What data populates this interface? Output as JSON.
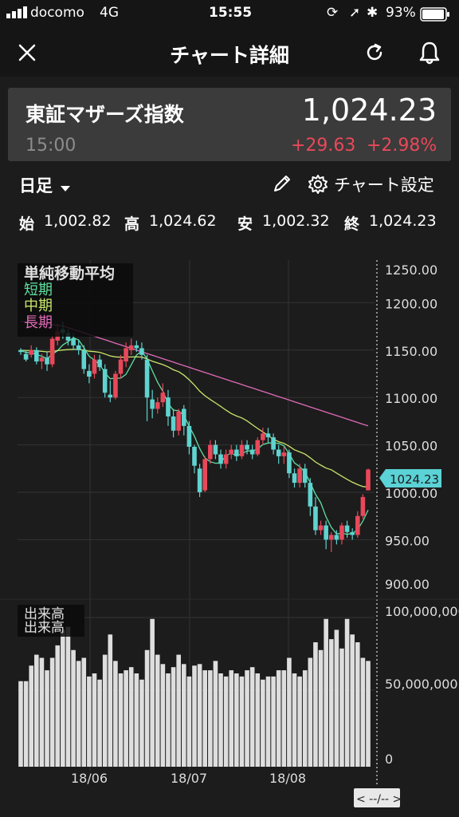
{
  "status_bar": {
    "carrier": "docomo",
    "network": "4G",
    "time": "15:55",
    "battery": "93%"
  },
  "nav": {
    "title": "チャート詳細"
  },
  "stock": {
    "name": "東証マザーズ指数",
    "price": "1,024.23",
    "time": "15:00",
    "change": "+29.63",
    "change_pct": "+2.98%"
  },
  "controls": {
    "period": "日足",
    "settings": "チャート設定"
  },
  "ohlc": {
    "open_label": "始",
    "open": "1,002.82",
    "high_label": "高",
    "high": "1,024.62",
    "low_label": "安",
    "low": "1,002.32",
    "close_label": "終",
    "close": "1,024.23"
  },
  "colors": {
    "up": "#e8485a",
    "down": "#5fd3cf",
    "short": "#5ee0a0",
    "mid": "#c8e66a",
    "long": "#e06ab8",
    "accent": "#5bd2d6"
  },
  "chart_data": {
    "type": "candlestick",
    "legend": {
      "title": "単純移動平均",
      "items": [
        "短期",
        "中期",
        "長期"
      ]
    },
    "y_ticks": [
      "1250.00",
      "1200.00",
      "1150.00",
      "1100.00",
      "1050.00",
      "1000.00",
      "950.00",
      "900.00"
    ],
    "x_ticks": [
      "18/06",
      "18/07",
      "18/08"
    ],
    "current_label": "1024.23",
    "volume_label": "出来高",
    "volume_ticks": [
      "100,000,000",
      "50,000,000",
      "0"
    ],
    "scroll_label": "< --/-- >",
    "candles": [
      [
        1150,
        1148,
        1152,
        1145
      ],
      [
        1146,
        1140,
        1150,
        1138
      ],
      [
        1145,
        1150,
        1155,
        1142
      ],
      [
        1150,
        1138,
        1153,
        1135
      ],
      [
        1138,
        1142,
        1146,
        1130
      ],
      [
        1142,
        1135,
        1148,
        1128
      ],
      [
        1135,
        1162,
        1165,
        1132
      ],
      [
        1160,
        1170,
        1178,
        1155
      ],
      [
        1172,
        1168,
        1180,
        1162
      ],
      [
        1168,
        1160,
        1172,
        1155
      ],
      [
        1162,
        1155,
        1168,
        1150
      ],
      [
        1155,
        1150,
        1160,
        1145
      ],
      [
        1150,
        1130,
        1155,
        1125
      ],
      [
        1128,
        1122,
        1135,
        1115
      ],
      [
        1125,
        1140,
        1145,
        1120
      ],
      [
        1140,
        1132,
        1145,
        1128
      ],
      [
        1130,
        1105,
        1135,
        1100
      ],
      [
        1103,
        1100,
        1118,
        1095
      ],
      [
        1100,
        1125,
        1128,
        1098
      ],
      [
        1125,
        1140,
        1145,
        1120
      ],
      [
        1138,
        1152,
        1158,
        1132
      ],
      [
        1150,
        1155,
        1162,
        1145
      ],
      [
        1155,
        1152,
        1160,
        1148
      ],
      [
        1152,
        1145,
        1158,
        1140
      ],
      [
        1140,
        1100,
        1145,
        1075
      ],
      [
        1098,
        1088,
        1108,
        1078
      ],
      [
        1088,
        1095,
        1100,
        1083
      ],
      [
        1095,
        1105,
        1115,
        1090
      ],
      [
        1100,
        1080,
        1108,
        1070
      ],
      [
        1080,
        1065,
        1088,
        1058
      ],
      [
        1065,
        1085,
        1088,
        1060
      ],
      [
        1088,
        1070,
        1092,
        1060
      ],
      [
        1070,
        1048,
        1075,
        1040
      ],
      [
        1048,
        1028,
        1050,
        1020
      ],
      [
        1025,
        1000,
        1030,
        995
      ],
      [
        1002,
        1035,
        1038,
        1000
      ],
      [
        1035,
        1050,
        1055,
        1030
      ],
      [
        1050,
        1040,
        1055,
        1035
      ],
      [
        1040,
        1030,
        1045,
        1025
      ],
      [
        1030,
        1040,
        1045,
        1025
      ],
      [
        1040,
        1045,
        1050,
        1035
      ],
      [
        1045,
        1038,
        1050,
        1033
      ],
      [
        1038,
        1050,
        1055,
        1035
      ],
      [
        1050,
        1045,
        1055,
        1040
      ],
      [
        1045,
        1040,
        1050,
        1035
      ],
      [
        1040,
        1055,
        1058,
        1038
      ],
      [
        1055,
        1062,
        1068,
        1050
      ],
      [
        1062,
        1058,
        1068,
        1052
      ],
      [
        1058,
        1045,
        1062,
        1040
      ],
      [
        1045,
        1038,
        1050,
        1030
      ],
      [
        1038,
        1042,
        1048,
        1030
      ],
      [
        1042,
        1020,
        1045,
        1015
      ],
      [
        1020,
        1010,
        1025,
        1005
      ],
      [
        1010,
        1025,
        1030,
        1005
      ],
      [
        1025,
        1010,
        1030,
        1005
      ],
      [
        1010,
        985,
        1015,
        975
      ],
      [
        985,
        960,
        995,
        955
      ],
      [
        960,
        965,
        970,
        955
      ],
      [
        965,
        950,
        970,
        940
      ],
      [
        950,
        955,
        958,
        937
      ],
      [
        955,
        950,
        960,
        945
      ],
      [
        950,
        965,
        968,
        945
      ],
      [
        965,
        958,
        970,
        952
      ],
      [
        958,
        955,
        962,
        950
      ],
      [
        955,
        975,
        980,
        952
      ],
      [
        975,
        995,
        998,
        972
      ],
      [
        1002,
        1024,
        1025,
        1002
      ]
    ],
    "volumes": [
      55,
      55,
      65,
      72,
      70,
      62,
      70,
      78,
      88,
      90,
      75,
      68,
      70,
      58,
      60,
      56,
      72,
      85,
      68,
      60,
      62,
      64,
      60,
      56,
      75,
      95,
      72,
      66,
      60,
      64,
      72,
      66,
      58,
      65,
      66,
      62,
      62,
      68,
      60,
      58,
      62,
      60,
      58,
      62,
      64,
      60,
      56,
      58,
      58,
      62,
      62,
      70,
      60,
      58,
      62,
      70,
      80,
      75,
      95,
      82,
      88,
      76,
      95,
      85,
      80,
      70,
      68
    ]
  }
}
